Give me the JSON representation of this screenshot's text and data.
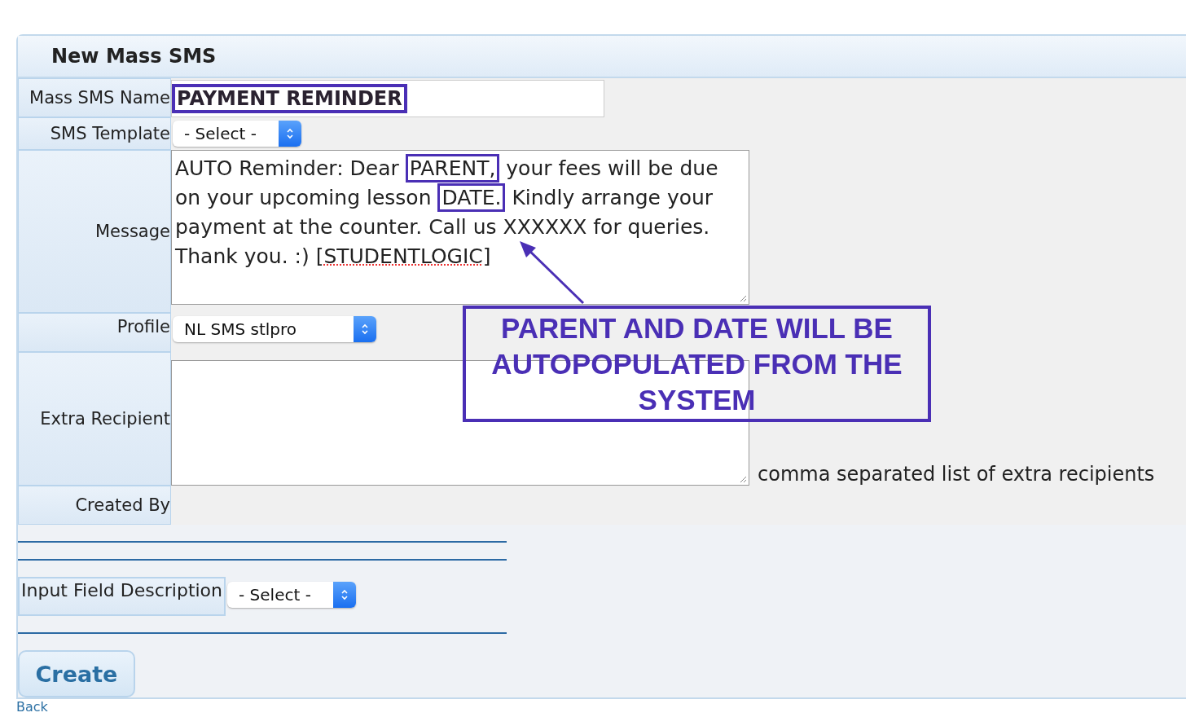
{
  "panel": {
    "title": "New Mass SMS"
  },
  "form": {
    "rows": [
      {
        "kind": "text",
        "label": "Mass SMS Name",
        "value": "PAYMENT REMINDER",
        "highlighted": true
      },
      {
        "kind": "select",
        "label": "SMS Template",
        "value": "- Select -"
      },
      {
        "kind": "message",
        "label": "Message",
        "segments": [
          {
            "kind": "plain",
            "text": "AUTO Reminder: Dear "
          },
          {
            "kind": "highlight",
            "text": "PARENT,"
          },
          {
            "kind": "plain",
            "text": " your fees will be due on your upcoming lesson "
          },
          {
            "kind": "highlight",
            "text": "DATE."
          },
          {
            "kind": "plain",
            "text": " Kindly arrange your payment at the counter. Call us XXXXXX for queries. Thank you. :) ["
          },
          {
            "kind": "misspelled",
            "text": "STUDENTLOGIC"
          },
          {
            "kind": "plain",
            "text": "]"
          }
        ]
      },
      {
        "kind": "select",
        "label": "Profile",
        "value": "NL SMS stlpro"
      },
      {
        "kind": "textarea",
        "label": "Extra Recipient",
        "hint": "comma separated list of extra recipients"
      },
      {
        "kind": "static",
        "label": "Created By"
      }
    ]
  },
  "input_field_description": {
    "label": "Input Field Description",
    "value": "- Select -"
  },
  "create_button": "Create",
  "back_link": "Back",
  "callout": "PARENT AND DATE WILL BE AUTOPOPULATED FROM THE SYSTEM"
}
